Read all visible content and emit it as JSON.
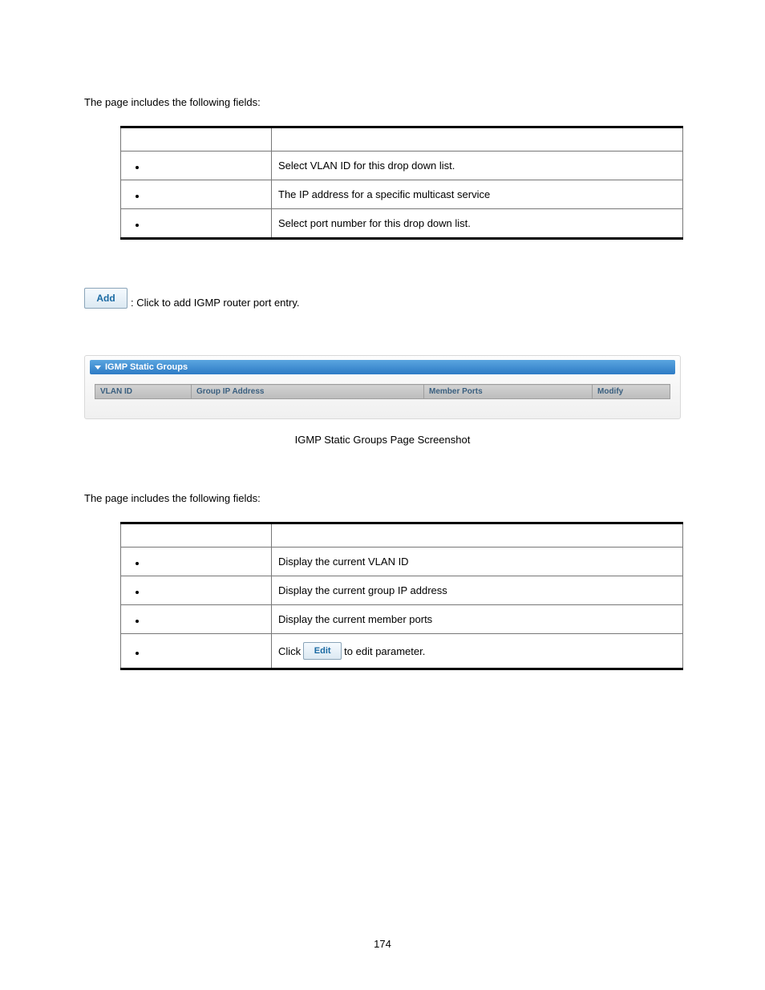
{
  "intro1": "The page includes the following fields:",
  "table1": {
    "rows": [
      {
        "desc": "Select VLAN ID for this drop down list."
      },
      {
        "desc": "The IP address for a specific multicast service"
      },
      {
        "desc": "Select port number for this drop down list."
      }
    ]
  },
  "addButton": {
    "label": "Add",
    "caption": ": Click to add IGMP router port entry."
  },
  "screenshot": {
    "panelTitle": "IGMP Static Groups",
    "cols": {
      "c1": "VLAN ID",
      "c2": "Group IP Address",
      "c3": "Member Ports",
      "c4": "Modify"
    }
  },
  "figCaption": "IGMP Static Groups Page Screenshot",
  "intro2": "The page includes the following fields:",
  "table2": {
    "rows": [
      {
        "desc": "Display the current VLAN ID"
      },
      {
        "desc": "Display the current group IP address"
      },
      {
        "desc": "Display the current member ports"
      }
    ],
    "modifyRow": {
      "pre": "Click ",
      "btn": "Edit",
      "post": " to edit parameter."
    }
  },
  "pageNumber": "174"
}
